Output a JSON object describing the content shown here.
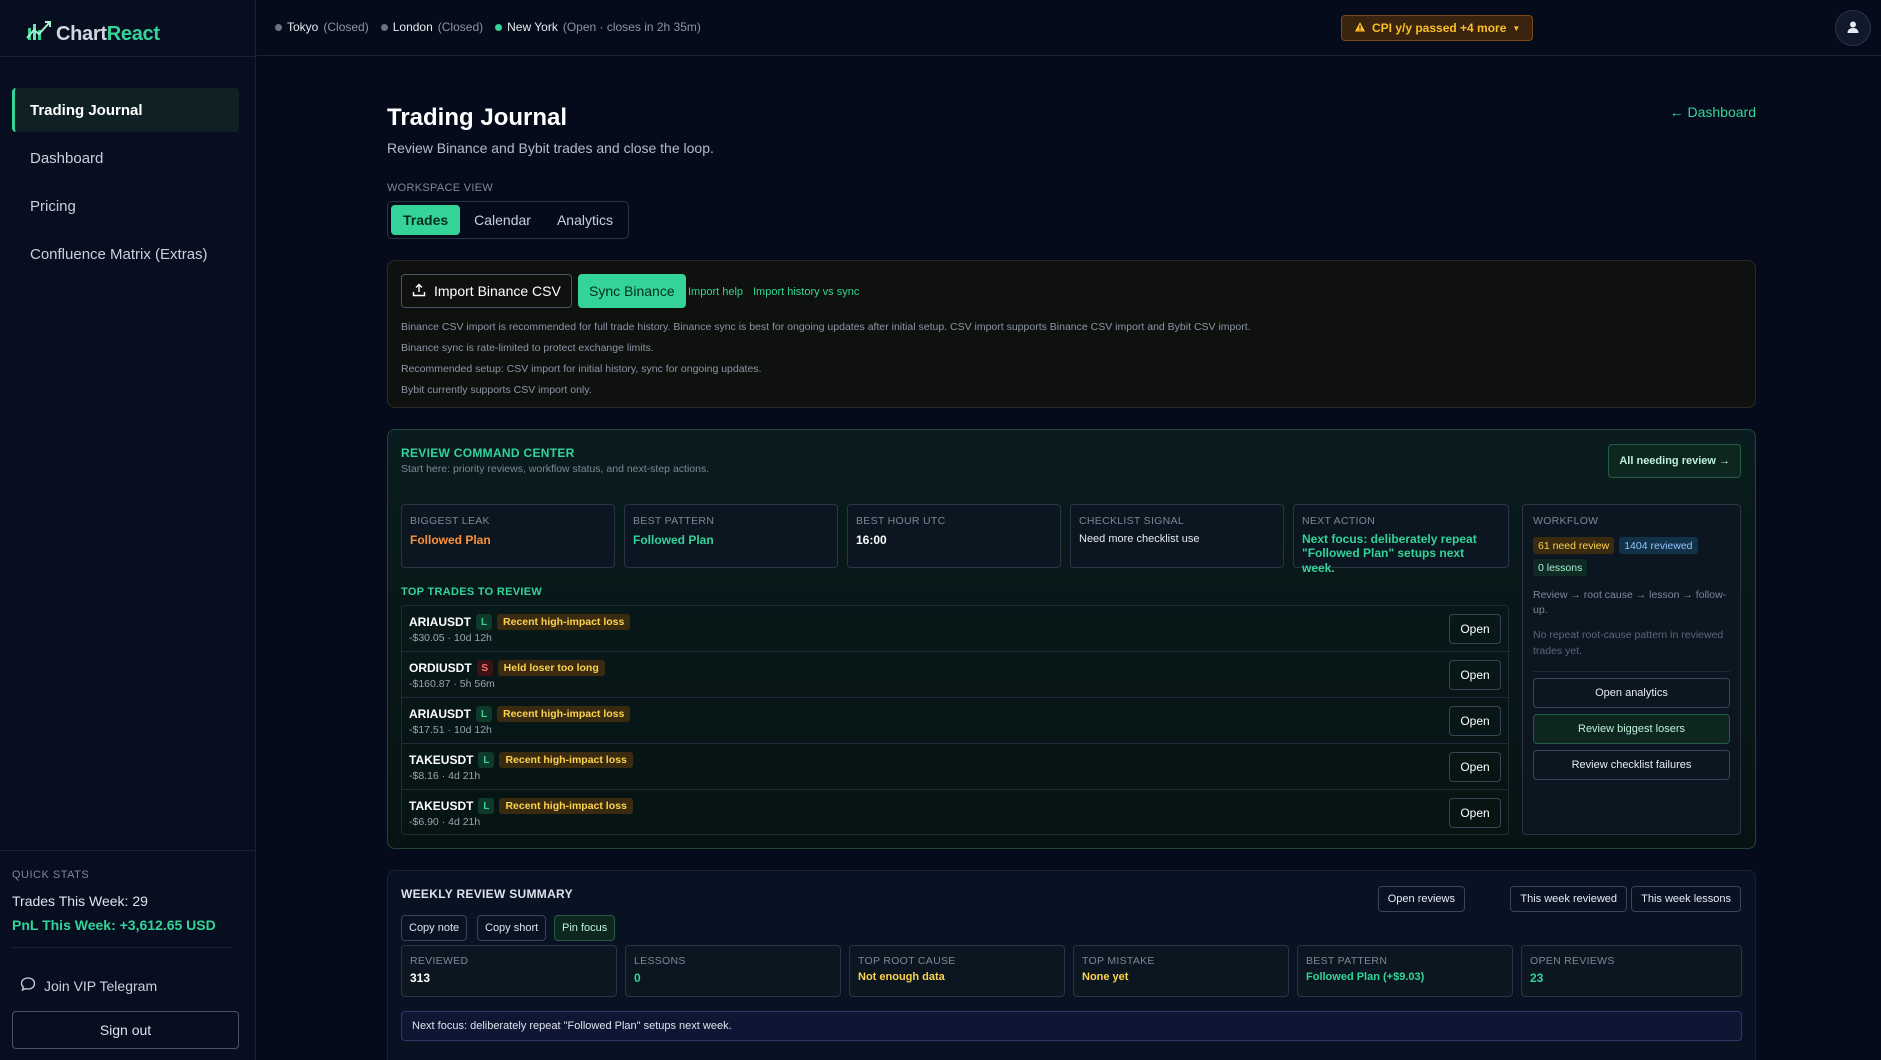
{
  "brand": {
    "name_part1": "Chart",
    "name_part2": "React"
  },
  "sidebar": {
    "items": [
      {
        "label": "Trading Journal",
        "active": true
      },
      {
        "label": "Dashboard"
      },
      {
        "label": "Pricing"
      },
      {
        "label": "Confluence Matrix (Extras)"
      }
    ],
    "quick_stats": {
      "title": "QUICK STATS",
      "trades": "Trades This Week: 29",
      "pnl": "PnL This Week: +3,612.65 USD"
    },
    "telegram": "Join VIP Telegram",
    "signout": "Sign out"
  },
  "topbar": {
    "markets": [
      {
        "name": "Tokyo",
        "status": "(Closed)",
        "open": false
      },
      {
        "name": "London",
        "status": "(Closed)",
        "open": false
      },
      {
        "name": "New York",
        "status": "(Open · closes in 2h 35m)",
        "open": true
      }
    ],
    "alert": "CPI y/y passed +4 more",
    "colors": {
      "accent": "#34d399",
      "warn": "#fbbf24"
    }
  },
  "page": {
    "title": "Trading Journal",
    "subtitle": "Review Binance and Bybit trades and close the loop.",
    "dashboard_link": "← Dashboard",
    "workspace_label": "WORKSPACE VIEW",
    "tabs": [
      "Trades",
      "Calendar",
      "Analytics"
    ]
  },
  "import": {
    "import_btn": "Import Binance CSV",
    "sync_btn": "Sync Binance",
    "help_link": "Import help",
    "history_link": "Import history vs sync",
    "notes": [
      "Binance CSV import is recommended for full trade history. Binance sync is best for ongoing updates after initial setup. CSV import supports Binance CSV import and Bybit CSV import.",
      "Binance sync is rate-limited to protect exchange limits.",
      "Recommended setup: CSV import for initial history, sync for ongoing updates.",
      "Bybit currently supports CSV import only."
    ]
  },
  "rcc": {
    "title": "REVIEW COMMAND CENTER",
    "subtitle": "Start here: priority reviews, workflow status, and next-step actions.",
    "all_btn": "All needing review →",
    "cards": [
      {
        "label": "BIGGEST LEAK",
        "value": "Followed Plan",
        "color": "#fb923c"
      },
      {
        "label": "BEST PATTERN",
        "value": "Followed Plan",
        "color": "#34d399"
      },
      {
        "label": "BEST HOUR UTC",
        "value": "16:00",
        "color": "#ffffff"
      },
      {
        "label": "CHECKLIST SIGNAL",
        "value": "Need more checklist use",
        "color": "#e6ebf2"
      },
      {
        "label": "NEXT ACTION",
        "value": "Next focus: deliberately repeat \"Followed Plan\" setups next week.",
        "color": "#34d399"
      }
    ],
    "top_trades_title": "TOP TRADES TO REVIEW",
    "trades": [
      {
        "symbol": "ARIAUSDT",
        "side": "L",
        "tag": "Recent high-impact loss",
        "meta": "-$30.05 · 10d 12h",
        "open": "Open"
      },
      {
        "symbol": "ORDIUSDT",
        "side": "S",
        "tag": "Held loser too long",
        "meta": "-$160.87 · 5h 56m",
        "open": "Open"
      },
      {
        "symbol": "ARIAUSDT",
        "side": "L",
        "tag": "Recent high-impact loss",
        "meta": "-$17.51 · 10d 12h",
        "open": "Open"
      },
      {
        "symbol": "TAKEUSDT",
        "side": "L",
        "tag": "Recent high-impact loss",
        "meta": "-$8.16 · 4d 21h",
        "open": "Open"
      },
      {
        "symbol": "TAKEUSDT",
        "side": "L",
        "tag": "Recent high-impact loss",
        "meta": "-$6.90 · 4d 21h",
        "open": "Open"
      }
    ],
    "workflow": {
      "title": "WORKFLOW",
      "badge_review": "61 need review",
      "badge_reviewed": "1404 reviewed",
      "badge_lessons": "0 lessons",
      "steps": "Review → root cause → lesson → follow-up.",
      "note": "No repeat root-cause pattern in reviewed trades yet.",
      "btn_analytics": "Open analytics",
      "btn_losers": "Review biggest losers",
      "btn_checklist": "Review checklist failures"
    }
  },
  "weekly": {
    "title": "WEEKLY REVIEW SUMMARY",
    "copy_note": "Copy note",
    "copy_short": "Copy short",
    "pin_focus": "Pin focus",
    "open_reviews": "Open reviews",
    "this_week_reviewed": "This week reviewed",
    "this_week_lessons": "This week lessons",
    "cards": [
      {
        "label": "REVIEWED",
        "value": "313",
        "color": "#ffffff"
      },
      {
        "label": "LESSONS",
        "value": "0",
        "color": "#34d399"
      },
      {
        "label": "TOP ROOT CAUSE",
        "value": "Not enough data",
        "color": "#fcd34d"
      },
      {
        "label": "TOP MISTAKE",
        "value": "None yet",
        "color": "#fcd34d"
      },
      {
        "label": "BEST PATTERN",
        "value": "Followed Plan (+$9.03)",
        "color": "#34d399"
      },
      {
        "label": "OPEN REVIEWS",
        "value": "23",
        "color": "#34d399"
      }
    ],
    "focus": "Next focus: deliberately repeat \"Followed Plan\" setups next week."
  }
}
